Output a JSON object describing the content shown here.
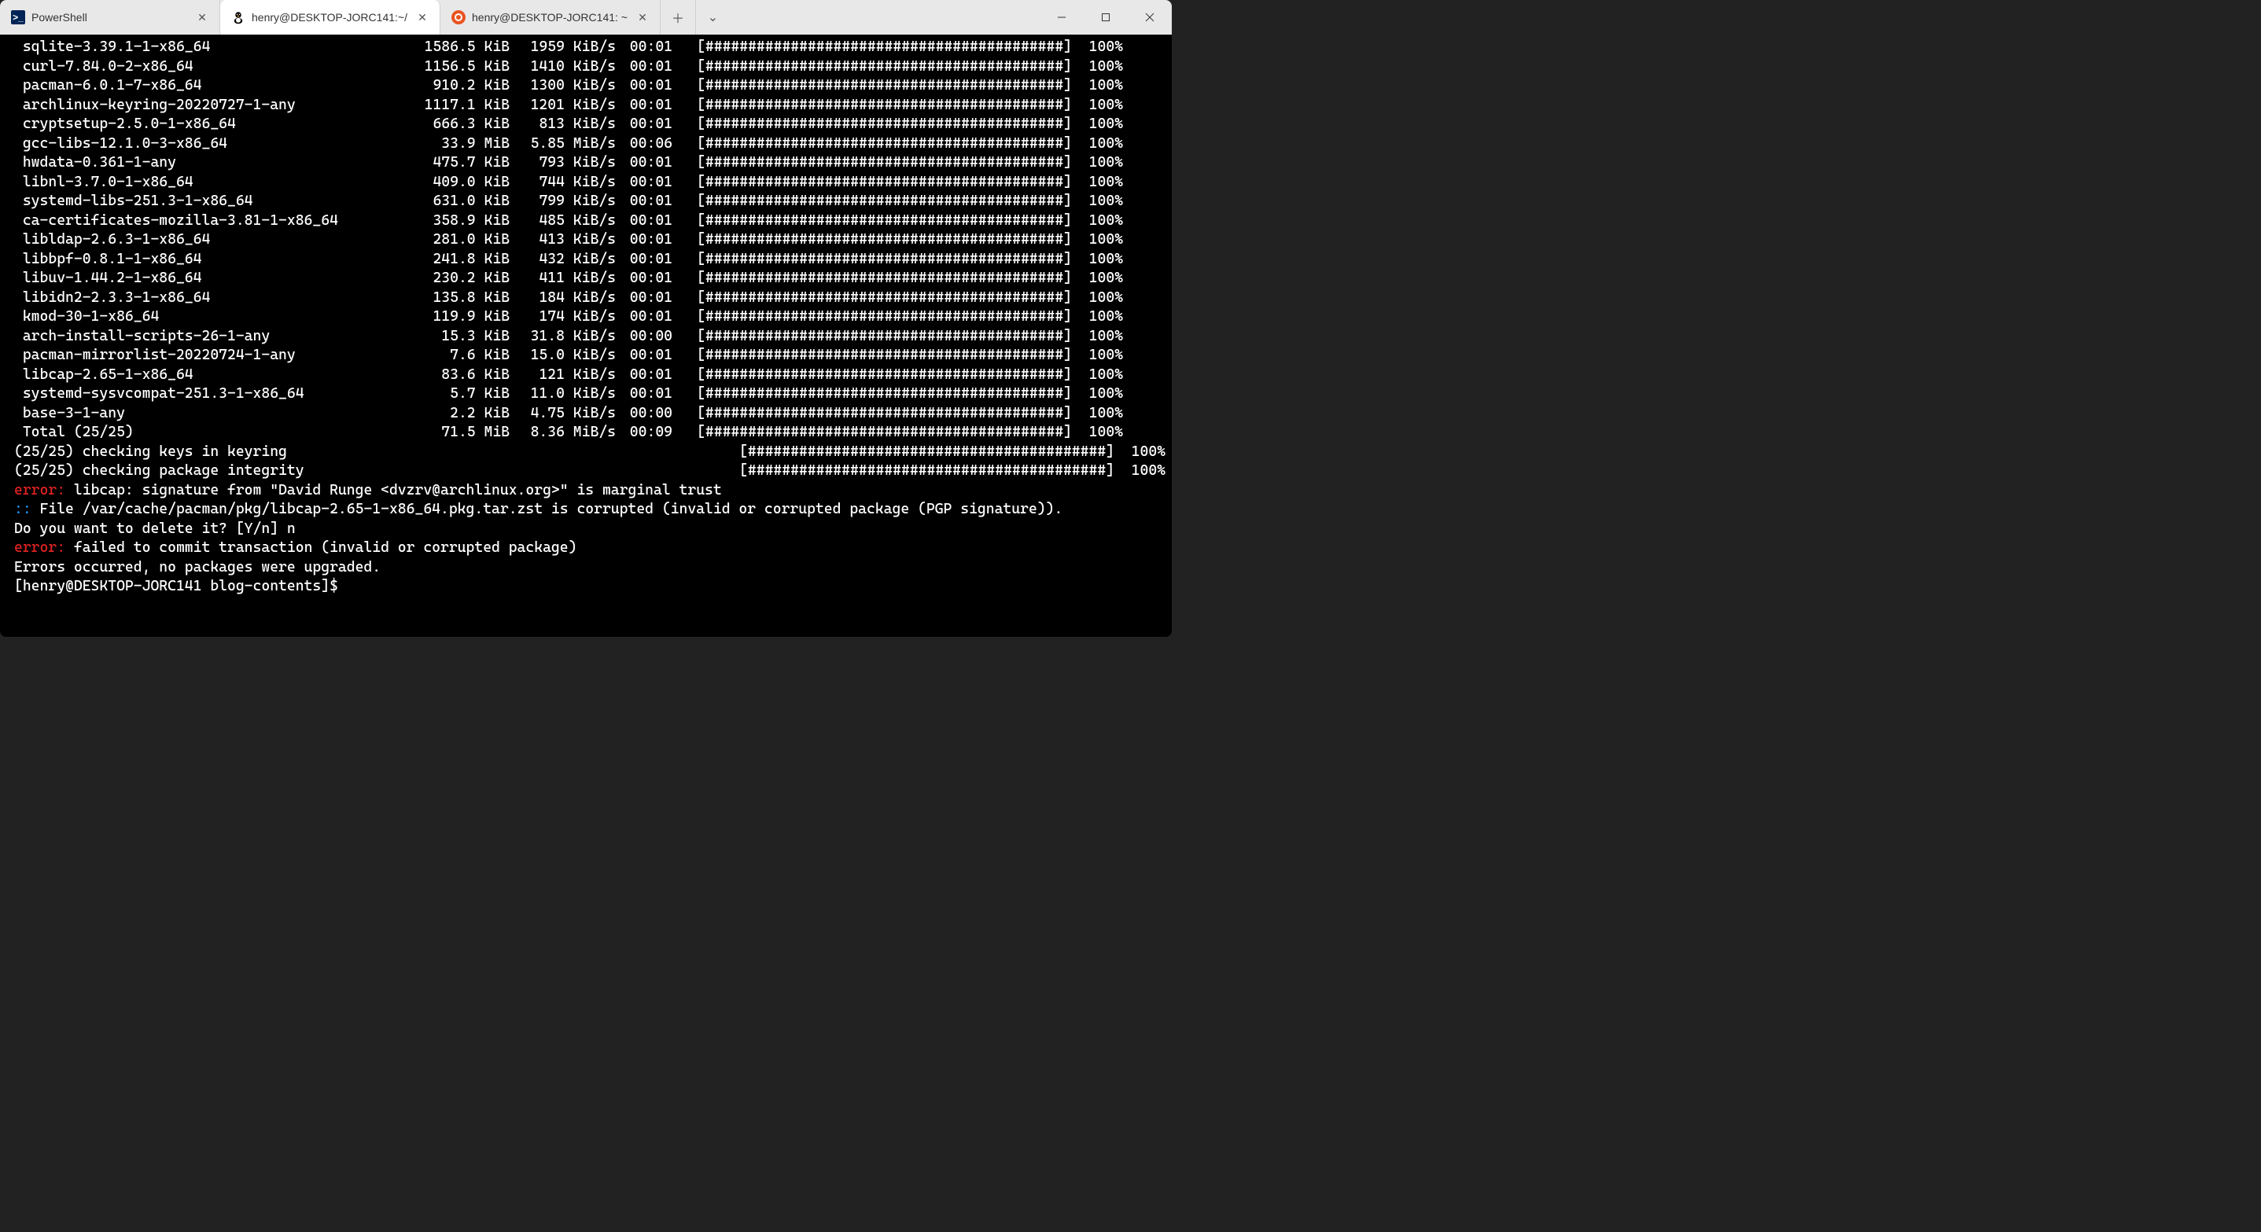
{
  "tabs": [
    {
      "label": "PowerShell",
      "icon": "powershell-icon"
    },
    {
      "label": "henry@DESKTOP-JORC141:~/",
      "icon": "tux-icon",
      "active": true
    },
    {
      "label": "henry@DESKTOP-JORC141: ~",
      "icon": "ubuntu-icon"
    }
  ],
  "progress_bar": "[##########################################]",
  "downloads": [
    {
      "pkg": " sqlite-3.39.1-1-x86_64",
      "size": "1586.5 KiB",
      "speed": "1959 KiB/s",
      "time": "00:01",
      "pct": "100%"
    },
    {
      "pkg": " curl-7.84.0-2-x86_64",
      "size": "1156.5 KiB",
      "speed": "1410 KiB/s",
      "time": "00:01",
      "pct": "100%"
    },
    {
      "pkg": " pacman-6.0.1-7-x86_64",
      "size": "910.2 KiB",
      "speed": "1300 KiB/s",
      "time": "00:01",
      "pct": "100%"
    },
    {
      "pkg": " archlinux-keyring-20220727-1-any",
      "size": "1117.1 KiB",
      "speed": "1201 KiB/s",
      "time": "00:01",
      "pct": "100%"
    },
    {
      "pkg": " cryptsetup-2.5.0-1-x86_64",
      "size": "666.3 KiB",
      "speed": "813 KiB/s",
      "time": "00:01",
      "pct": "100%"
    },
    {
      "pkg": " gcc-libs-12.1.0-3-x86_64",
      "size": "33.9 MiB",
      "speed": "5.85 MiB/s",
      "time": "00:06",
      "pct": "100%"
    },
    {
      "pkg": " hwdata-0.361-1-any",
      "size": "475.7 KiB",
      "speed": "793 KiB/s",
      "time": "00:01",
      "pct": "100%"
    },
    {
      "pkg": " libnl-3.7.0-1-x86_64",
      "size": "409.0 KiB",
      "speed": "744 KiB/s",
      "time": "00:01",
      "pct": "100%"
    },
    {
      "pkg": " systemd-libs-251.3-1-x86_64",
      "size": "631.0 KiB",
      "speed": "799 KiB/s",
      "time": "00:01",
      "pct": "100%"
    },
    {
      "pkg": " ca-certificates-mozilla-3.81-1-x86_64",
      "size": "358.9 KiB",
      "speed": "485 KiB/s",
      "time": "00:01",
      "pct": "100%"
    },
    {
      "pkg": " libldap-2.6.3-1-x86_64",
      "size": "281.0 KiB",
      "speed": "413 KiB/s",
      "time": "00:01",
      "pct": "100%"
    },
    {
      "pkg": " libbpf-0.8.1-1-x86_64",
      "size": "241.8 KiB",
      "speed": "432 KiB/s",
      "time": "00:01",
      "pct": "100%"
    },
    {
      "pkg": " libuv-1.44.2-1-x86_64",
      "size": "230.2 KiB",
      "speed": "411 KiB/s",
      "time": "00:01",
      "pct": "100%"
    },
    {
      "pkg": " libidn2-2.3.3-1-x86_64",
      "size": "135.8 KiB",
      "speed": "184 KiB/s",
      "time": "00:01",
      "pct": "100%"
    },
    {
      "pkg": " kmod-30-1-x86_64",
      "size": "119.9 KiB",
      "speed": "174 KiB/s",
      "time": "00:01",
      "pct": "100%"
    },
    {
      "pkg": " arch-install-scripts-26-1-any",
      "size": "15.3 KiB",
      "speed": "31.8 KiB/s",
      "time": "00:00",
      "pct": "100%"
    },
    {
      "pkg": " pacman-mirrorlist-20220724-1-any",
      "size": "7.6 KiB",
      "speed": "15.0 KiB/s",
      "time": "00:01",
      "pct": "100%"
    },
    {
      "pkg": " libcap-2.65-1-x86_64",
      "size": "83.6 KiB",
      "speed": "121 KiB/s",
      "time": "00:01",
      "pct": "100%"
    },
    {
      "pkg": " systemd-sysvcompat-251.3-1-x86_64",
      "size": "5.7 KiB",
      "speed": "11.0 KiB/s",
      "time": "00:01",
      "pct": "100%"
    },
    {
      "pkg": " base-3-1-any",
      "size": "2.2 KiB",
      "speed": "4.75 KiB/s",
      "time": "00:00",
      "pct": "100%"
    },
    {
      "pkg": " Total (25/25)",
      "size": "71.5 MiB",
      "speed": "8.36 MiB/s",
      "time": "00:09",
      "pct": "100%"
    }
  ],
  "checks": [
    {
      "left": "(25/25) checking keys in keyring",
      "pct": "100%"
    },
    {
      "left": "(25/25) checking package integrity",
      "pct": "100%"
    }
  ],
  "lines": {
    "err1_prefix": "error:",
    "err1_rest": " libcap: signature from \"David Runge <dvzrv@archlinux.org>\" is marginal trust",
    "info_prefix": "::",
    "info_rest": " File /var/cache/pacman/pkg/libcap-2.65-1-x86_64.pkg.tar.zst is corrupted (invalid or corrupted package (PGP signature)).",
    "prompt_delete": "Do you want to delete it? [Y/n] n",
    "err2_prefix": "error:",
    "err2_rest": " failed to commit transaction (invalid or corrupted package)",
    "errors_occurred": "Errors occurred, no packages were upgraded.",
    "shell_prompt": "[henry@DESKTOP-JORC141 blog-contents]$ "
  }
}
